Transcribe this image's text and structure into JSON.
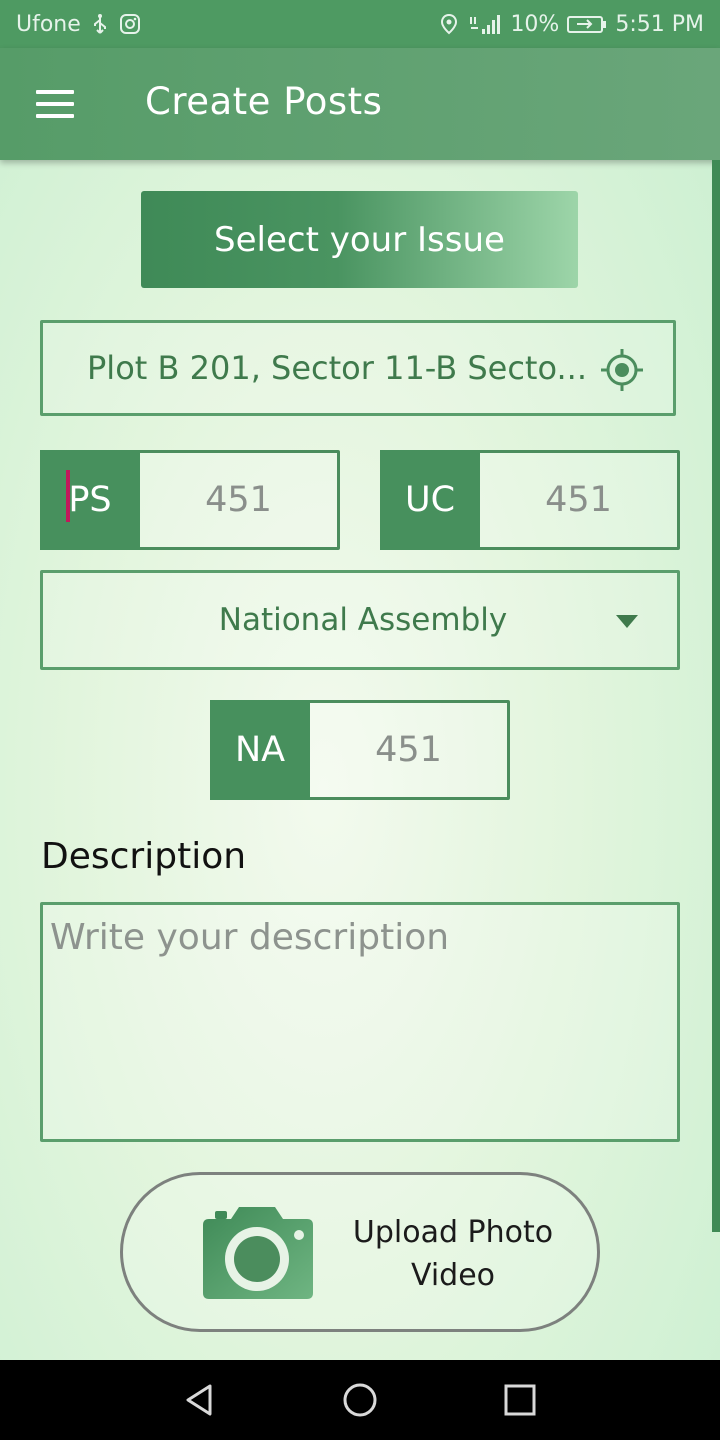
{
  "status_bar": {
    "carrier": "Ufone",
    "battery": "10%",
    "time": "5:51 PM"
  },
  "app_bar": {
    "title": "Create Posts"
  },
  "form": {
    "issue_button": "Select your Issue",
    "location": "Plot B 201, Sector 11-B Secto...",
    "ps": {
      "label": "PS",
      "value": "451"
    },
    "uc": {
      "label": "UC",
      "value": "451"
    },
    "assembly_select": "National Assembly",
    "na": {
      "label": "NA",
      "value": "451"
    },
    "description_label": "Description",
    "description_placeholder": "Write your description",
    "upload_line1": "Upload Photo",
    "upload_line2": "Video"
  },
  "colors": {
    "primary": "#47905d",
    "status_bar": "#4e9a62",
    "accent_cursor": "#c2185b"
  },
  "icons": [
    "menu-icon",
    "my-location-icon",
    "dropdown-arrow-icon",
    "camera-icon",
    "back-icon",
    "home-icon",
    "recents-icon"
  ]
}
